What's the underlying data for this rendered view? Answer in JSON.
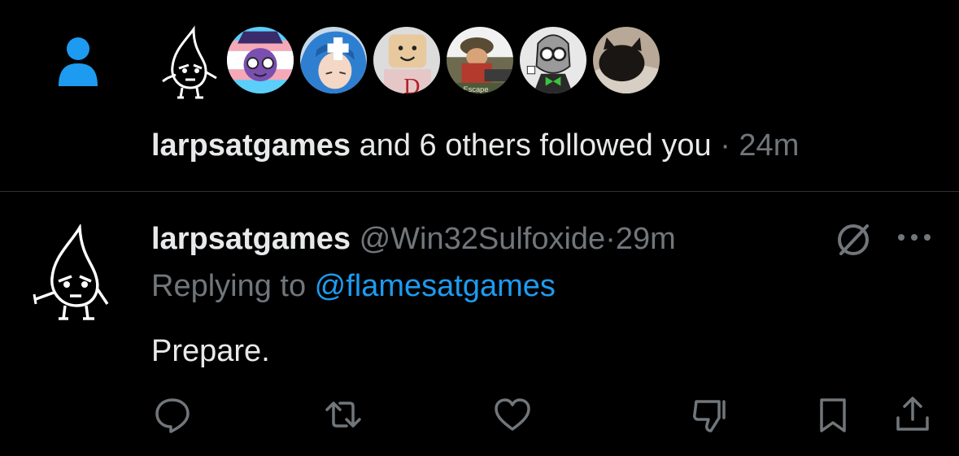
{
  "notification": {
    "actor": "larpsatgames",
    "text_middle": " and 6 others followed you",
    "separator": " · ",
    "time": "24m",
    "avatars": [
      {
        "name": "larpsatgames",
        "kind": "flame-doodle"
      },
      {
        "name": "follower-2",
        "kind": "trans-flag-character"
      },
      {
        "name": "follower-3",
        "kind": "blue-hair-anime"
      },
      {
        "name": "follower-4",
        "kind": "roblox-smile",
        "visible_text": "D"
      },
      {
        "name": "follower-5",
        "kind": "tf2-soldier",
        "visible_text": "Escape"
      },
      {
        "name": "follower-6",
        "kind": "bowtie-glasses-character"
      },
      {
        "name": "follower-7",
        "kind": "black-cat"
      }
    ]
  },
  "tweet": {
    "display_name": "larpsatgames",
    "handle": "@Win32Sulfoxide",
    "separator": "·",
    "time": "29m",
    "replying_prefix": "Replying to ",
    "replying_to": "@flamesatgames",
    "text": "Prepare."
  },
  "actions": [
    "reply-icon",
    "retweet-icon",
    "like-icon",
    "dislike-icon",
    "bookmark-icon",
    "share-icon"
  ],
  "colors": {
    "background": "#000000",
    "text": "#e7e9ea",
    "muted": "#71767b",
    "accent": "#1d9bf0",
    "divider": "#2f3336"
  }
}
